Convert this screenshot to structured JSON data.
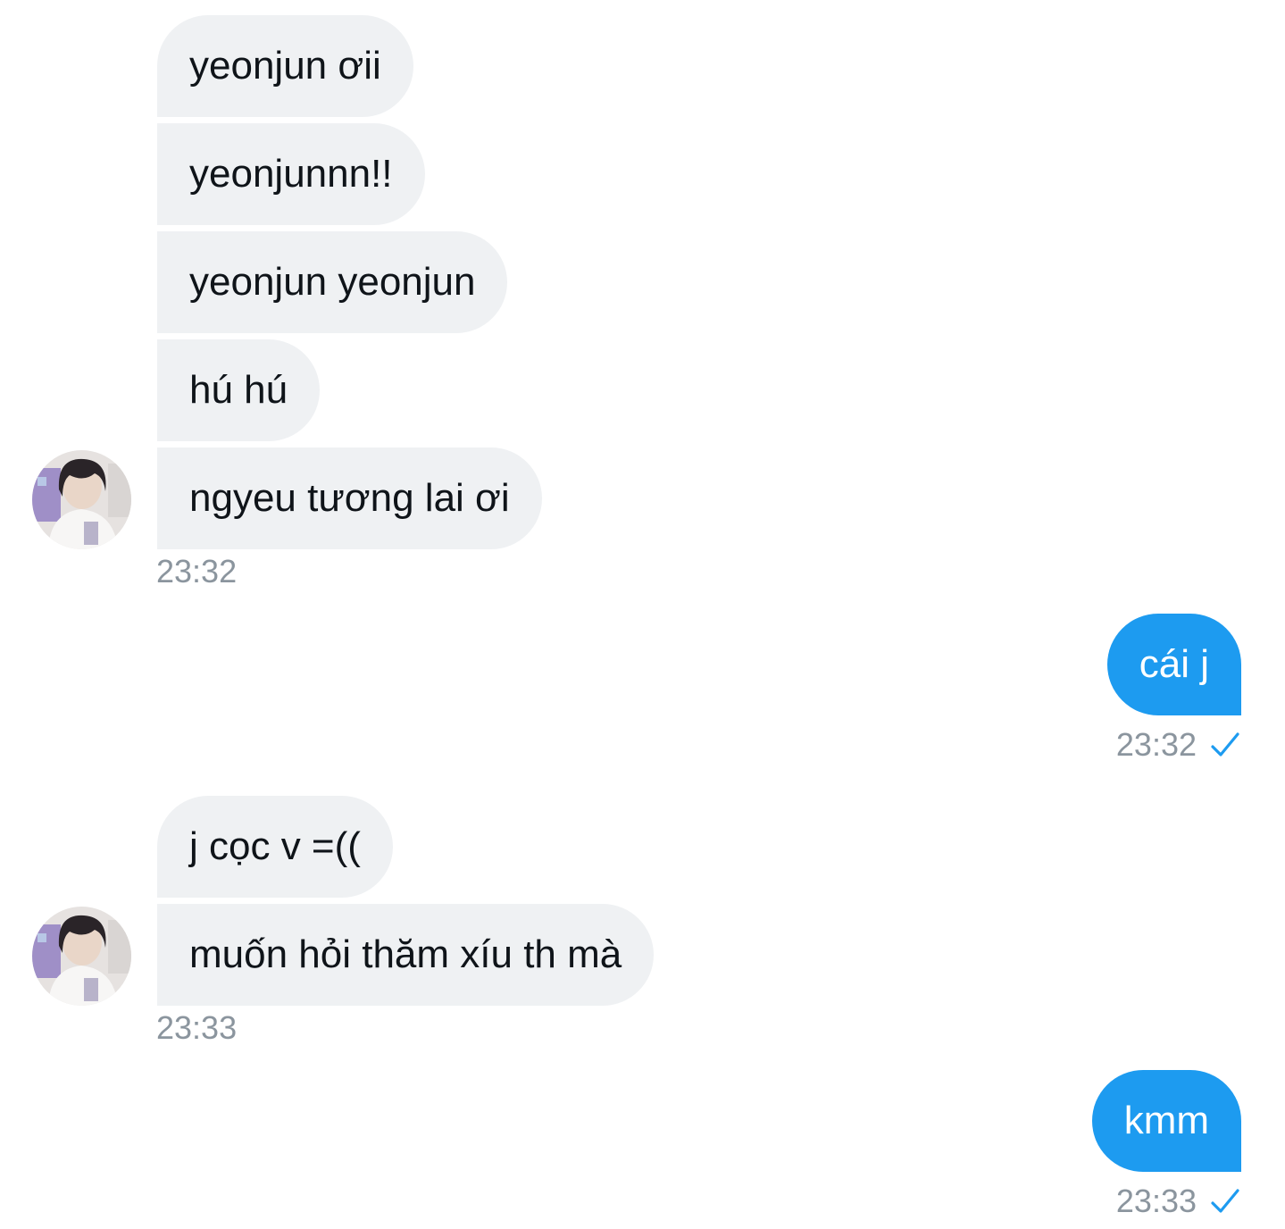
{
  "conversation": {
    "group1": {
      "messages": [
        "yeonjun ơii",
        "yeonjunnn!!",
        "yeonjun yeonjun",
        "hú hú",
        "ngyeu tương lai ơi"
      ],
      "time": "23:32"
    },
    "reply1": {
      "text": "cái j",
      "time": "23:32",
      "status_icon": "check-icon"
    },
    "group2": {
      "messages": [
        "j cọc v =((",
        "muốn hỏi thăm xíu th mà"
      ],
      "time": "23:33"
    },
    "reply2": {
      "text": "kmm",
      "time": "23:33",
      "status_icon": "check-icon"
    }
  },
  "colors": {
    "incoming_bubble": "#eff1f3",
    "outgoing_bubble": "#1d9bf0",
    "timestamp": "#8b959e",
    "check": "#1d9bf0"
  }
}
